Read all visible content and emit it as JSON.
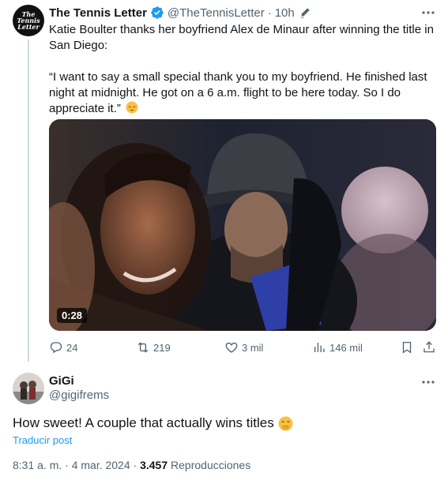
{
  "tweet": {
    "author_name": "The Tennis Letter",
    "avatar_lines": [
      "The",
      "Tennis",
      "Letter"
    ],
    "handle": "@TheTennisLetter",
    "separator": "·",
    "time": "10h",
    "text_line1": "Katie Boulter thanks her boyfriend Alex de Minaur after winning the title in San Diego:",
    "quote": "“I want to say a small special thank you to my boyfriend. He finished last night at midnight. He got on a 6 a.m. flight to be here today. So I do appreciate it.”",
    "video_duration": "0:28",
    "replies": "24",
    "reposts": "219",
    "likes": "3 mil",
    "views": "146 mil"
  },
  "reply": {
    "author_name": "GiGi",
    "handle": "@gigifrems",
    "text": "How sweet! A couple that actually wins titles",
    "translate_label": "Traducir post",
    "timestamp": "8:31 a. m. · 4 mar. 2024",
    "separator": "·",
    "views_count": "3.457",
    "views_label": "Reproducciones"
  },
  "colors": {
    "accent": "#1d9bf0",
    "secondary_text": "#536471",
    "primary_text": "#0f1419"
  }
}
